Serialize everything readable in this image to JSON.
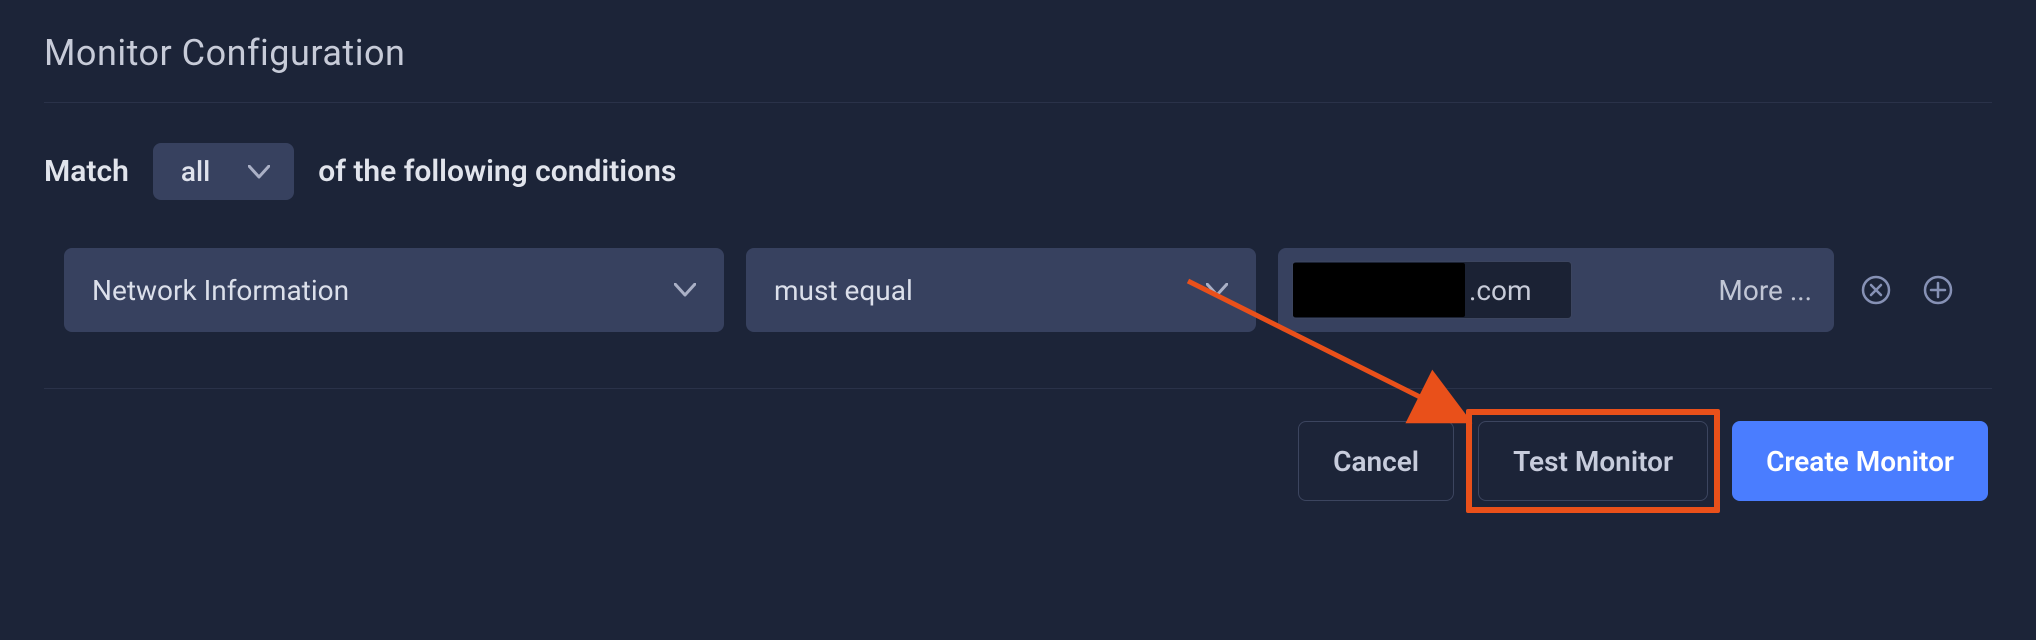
{
  "title": "Monitor Configuration",
  "match_row": {
    "prefix": "Match",
    "selector_value": "all",
    "suffix": "of the following conditions"
  },
  "condition": {
    "field": "Network Information",
    "operator": "must equal",
    "value_visible": ".com",
    "more_label": "More ..."
  },
  "buttons": {
    "cancel": "Cancel",
    "test": "Test Monitor",
    "create": "Create Monitor"
  }
}
